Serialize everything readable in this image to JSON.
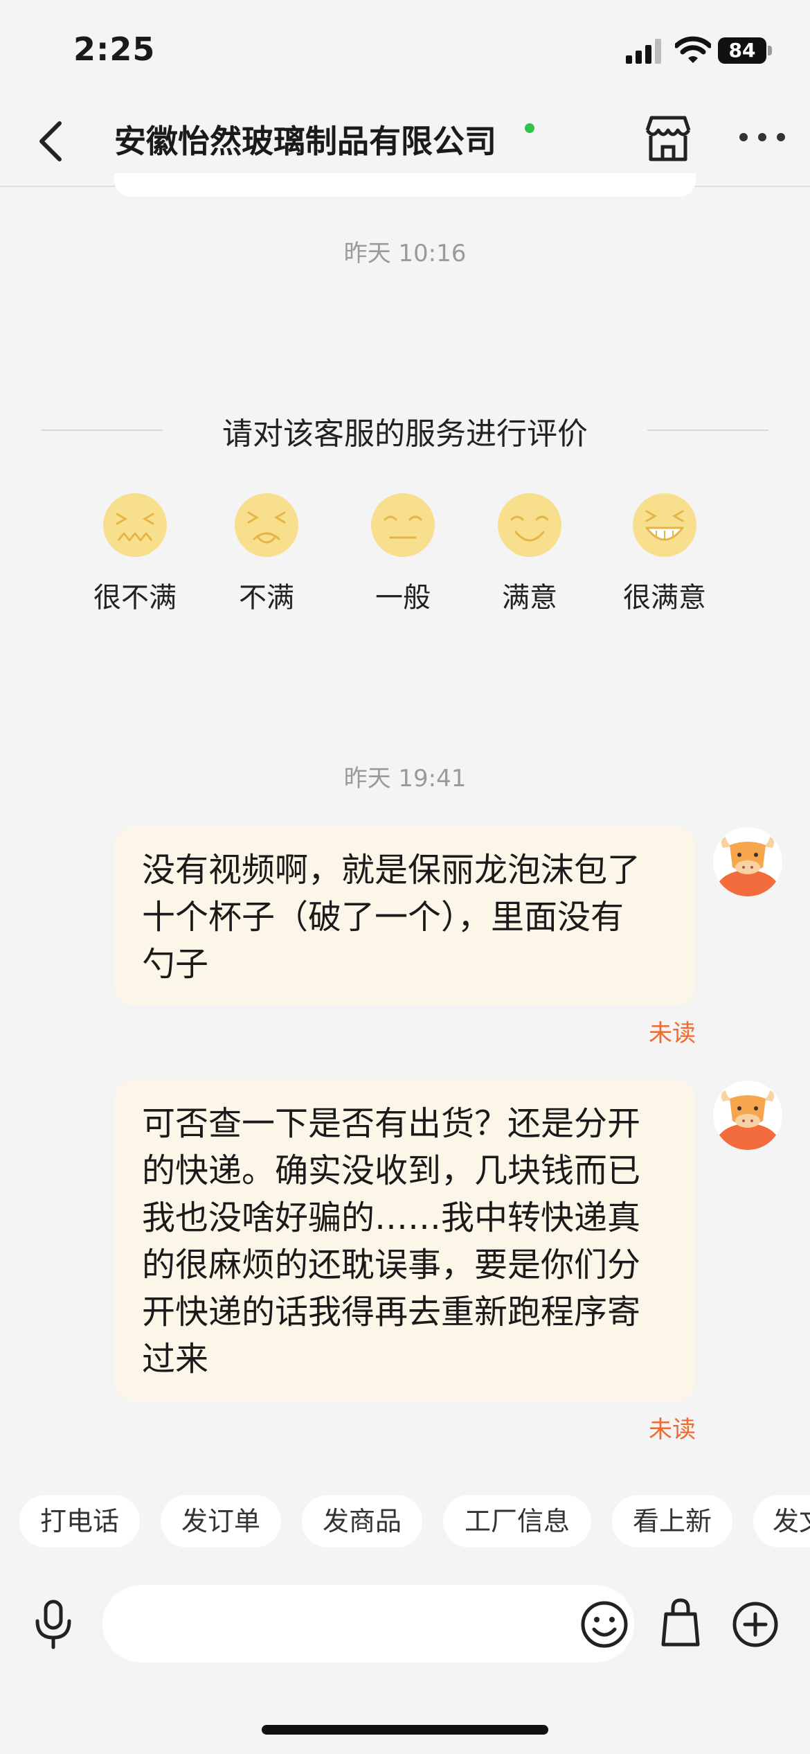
{
  "status_bar": {
    "time": "2:25",
    "battery": "84"
  },
  "nav": {
    "title": "安徽怡然玻璃制品有限公司"
  },
  "timestamps": {
    "first": "昨天 10:16",
    "second": "昨天 19:41"
  },
  "rating": {
    "title": "请对该客服的服务进行评价",
    "options": [
      {
        "label": "很不满",
        "icon": "very-dissatisfied-face-icon"
      },
      {
        "label": "不满",
        "icon": "dissatisfied-face-icon"
      },
      {
        "label": "一般",
        "icon": "neutral-face-icon"
      },
      {
        "label": "满意",
        "icon": "satisfied-face-icon"
      },
      {
        "label": "很满意",
        "icon": "very-satisfied-face-icon"
      }
    ],
    "face_color": "#f7df8e"
  },
  "messages": [
    {
      "lines": [
        "没有视频啊，就是保丽龙泡沫包了",
        "十个杯子（破了一个），里面没有",
        "勺子"
      ],
      "status": "未读"
    },
    {
      "lines": [
        "可否查一下是否有出货？还是分开",
        "的快递。确实没收到，几块钱而已",
        "我也没啥好骗的……我中转快递真",
        "的很麻烦的还耽误事，要是你们分",
        "开快递的话我得再去重新跑程序寄",
        "过来"
      ],
      "status": "未读"
    }
  ],
  "quick_replies": [
    "打电话",
    "发订单",
    "发商品",
    "工厂信息",
    "看上新",
    "发文"
  ],
  "input": {
    "placeholder": ""
  },
  "colors": {
    "bubble": "#fcf6e9",
    "unread": "#ee6a2f",
    "online": "#33c24d",
    "background": "#f4f4f4"
  }
}
